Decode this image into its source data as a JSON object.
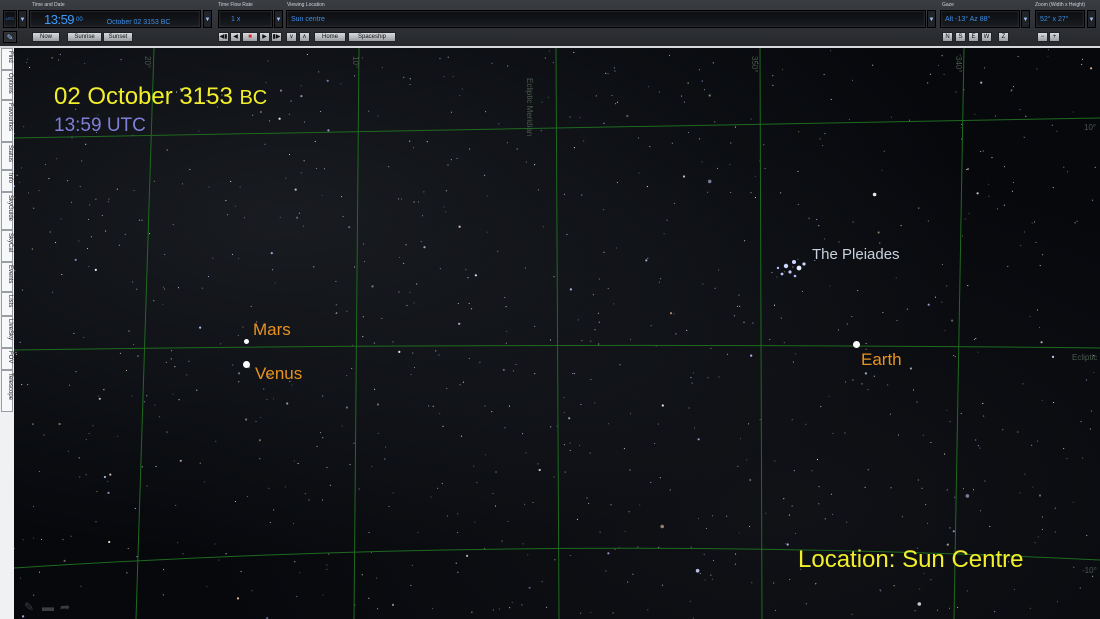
{
  "toolbar": {
    "time_date_label": "Time and Date",
    "time_main": "13:59",
    "time_seconds": "00",
    "date": "October 02  3153 BC",
    "utc_badge": "UTC",
    "time_flow_label": "Time Flow Rate",
    "time_flow_value": "1 x",
    "viewing_location_label": "Viewing Location",
    "viewing_location_value": "Sun centre",
    "gaze_label": "Gaze",
    "gaze_value": "Alt -13° Az 88°",
    "zoom_label": "Zoom (Width x Height)",
    "zoom_value": "52° x 27°",
    "buttons": {
      "now": "Now",
      "sunrise": "Sunrise",
      "sunset": "Sunset",
      "home": "Home",
      "spaceship": "Spaceship",
      "down": "∨",
      "up": "∧",
      "n": "N",
      "s": "S",
      "e": "E",
      "w": "W",
      "z": "Z",
      "zoom_out": "−",
      "zoom_in": "+"
    },
    "playback": [
      "◀▮",
      "◀",
      "■",
      "▶",
      "▮▶"
    ]
  },
  "sidebar_tabs": [
    "Find",
    "Options",
    "Favourites",
    "Status",
    "Info",
    "SkyGuide",
    "SkyCal",
    "Events",
    "Lists",
    "LiveSky",
    "FOV",
    "Telescope"
  ],
  "overlay": {
    "date_main": "02 October 3153",
    "date_era": "BC",
    "time_utc": "13:59 UTC",
    "location": "Location: Sun Centre"
  },
  "objects": {
    "mars": "Mars",
    "venus": "Venus",
    "earth": "Earth",
    "pleiades": "The Pleiades"
  },
  "grid_labels": {
    "ecliptic_meridian": "Ecliptic Meridian",
    "ecliptic": "Ecliptic",
    "lat_pos": "10°",
    "lat_neg": "-10°",
    "lon_20": "20°",
    "lon_10": "10°",
    "lon_350": "350°",
    "lon_340": "340°"
  },
  "colors": {
    "date_yellow": "#f2ef2a",
    "time_blue": "#7f7fd8",
    "planet_orange": "#e8931f",
    "pleiades_label": "#c8d2df",
    "grid_green": "#1f6a1f",
    "toolbar_blue": "#3c9bff"
  }
}
